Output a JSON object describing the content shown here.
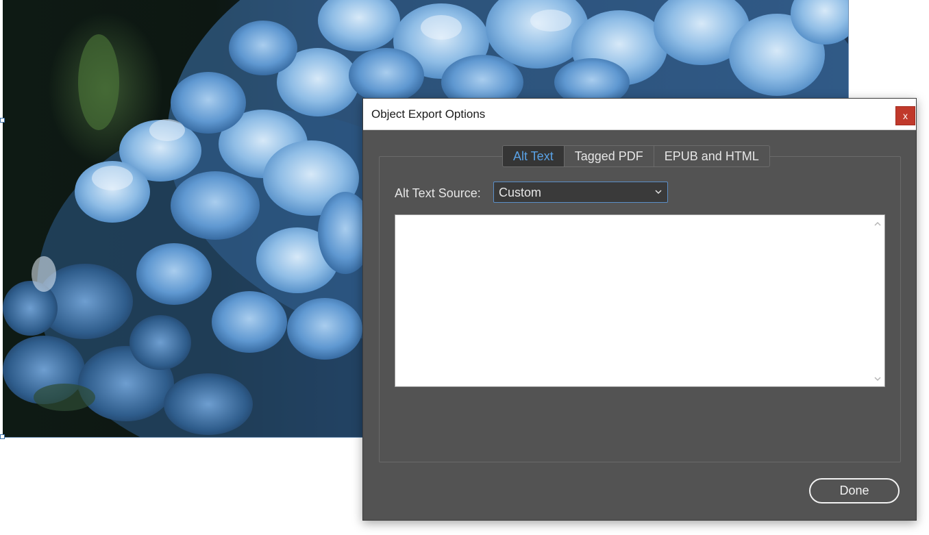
{
  "dialog": {
    "title": "Object Export Options",
    "close_label": "x",
    "tabs": [
      {
        "label": "Alt Text",
        "active": true
      },
      {
        "label": "Tagged PDF",
        "active": false
      },
      {
        "label": "EPUB and HTML",
        "active": false
      }
    ],
    "alt_text_source": {
      "label": "Alt Text Source:",
      "value": "Custom"
    },
    "alt_text": {
      "value": ""
    },
    "done_label": "Done"
  },
  "image": {
    "icon": "photo-of-blue-hydrangea"
  },
  "colors": {
    "dialog_bg": "#535353",
    "active_tab_text": "#5aa2e6",
    "close_button": "#c0392b",
    "select_border": "#5b8fc8"
  }
}
